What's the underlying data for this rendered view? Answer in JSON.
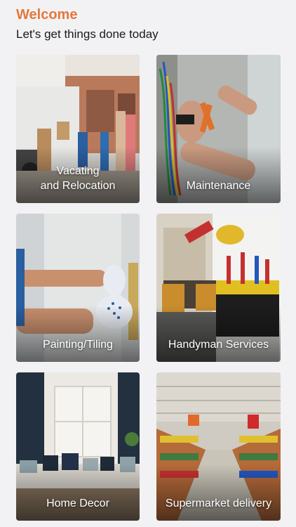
{
  "header": {
    "title": "Welcome",
    "subtitle": "Let's get things done today"
  },
  "colors": {
    "accent": "#e4783a",
    "background": "#f2f2f4"
  },
  "services": [
    {
      "label": "Vacating\nand Relocation",
      "icon": "moving-truck-photo"
    },
    {
      "label": "Maintenance",
      "icon": "electrician-wires-photo"
    },
    {
      "label": "Painting/Tiling",
      "icon": "gloved-hand-painting-photo"
    },
    {
      "label": "Handyman Services",
      "icon": "tool-belt-photo"
    },
    {
      "label": "Home Decor",
      "icon": "living-room-sofa-photo"
    },
    {
      "label": "Supermarket delivery",
      "icon": "supermarket-aisle-photo"
    }
  ]
}
